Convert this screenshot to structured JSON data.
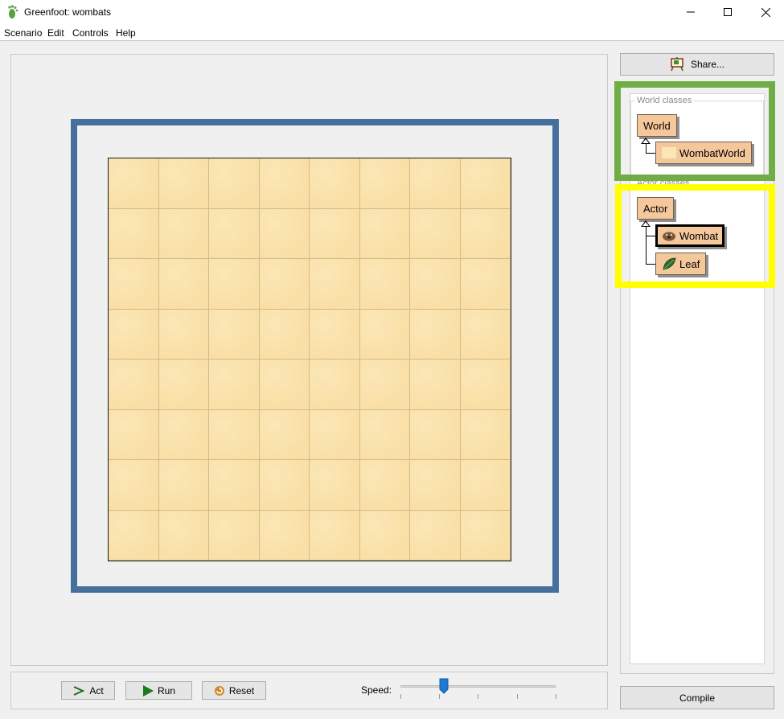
{
  "window": {
    "title": "Greenfoot: wombats"
  },
  "menu": [
    "Scenario",
    "Edit",
    "Controls",
    "Help"
  ],
  "world": {
    "columns": 8,
    "rows": 8
  },
  "controls": {
    "act": "Act",
    "run": "Run",
    "reset": "Reset",
    "speed_label": "Speed:",
    "speed_value_fraction": 0.28
  },
  "sidebar": {
    "share_label": "Share...",
    "world_classes_label": "World classes",
    "actor_classes_label": "Actor classes",
    "world_classes": {
      "root": "World",
      "child": "WombatWorld"
    },
    "actor_classes": {
      "root": "Actor",
      "children": [
        "Wombat",
        "Leaf"
      ]
    },
    "compile_label": "Compile"
  },
  "colors": {
    "world_frame": "#45709e",
    "class_box": "#f5c89c",
    "highlight_world": "#70ad47",
    "highlight_actor": "#ffff00"
  }
}
